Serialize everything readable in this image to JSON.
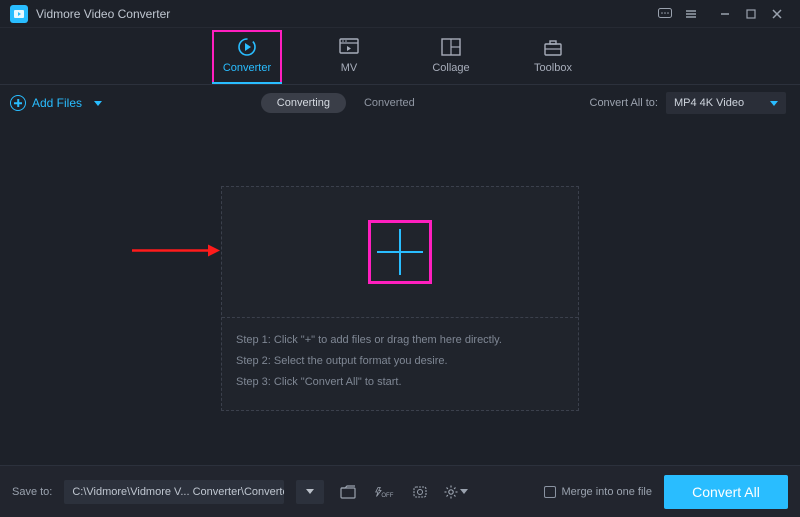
{
  "app": {
    "title": "Vidmore Video Converter"
  },
  "tabs": [
    {
      "label": "Converter",
      "active": true
    },
    {
      "label": "MV",
      "active": false
    },
    {
      "label": "Collage",
      "active": false
    },
    {
      "label": "Toolbox",
      "active": false
    }
  ],
  "toolbar": {
    "add_files_label": "Add Files",
    "segments": {
      "converting": "Converting",
      "converted": "Converted",
      "active": "converting"
    },
    "convert_all_to_label": "Convert All to:",
    "output_format": "MP4 4K Video"
  },
  "dropzone": {
    "steps": [
      "Step 1: Click \"+\" to add files or drag them here directly.",
      "Step 2: Select the output format you desire.",
      "Step 3: Click \"Convert All\" to start."
    ]
  },
  "footer": {
    "save_to_label": "Save to:",
    "save_path": "C:\\Vidmore\\Vidmore V... Converter\\Converted",
    "merge_label": "Merge into one file",
    "convert_all_label": "Convert All"
  },
  "colors": {
    "accent": "#29bdff",
    "highlight": "#ff1fbf",
    "bg": "#1d2129"
  }
}
